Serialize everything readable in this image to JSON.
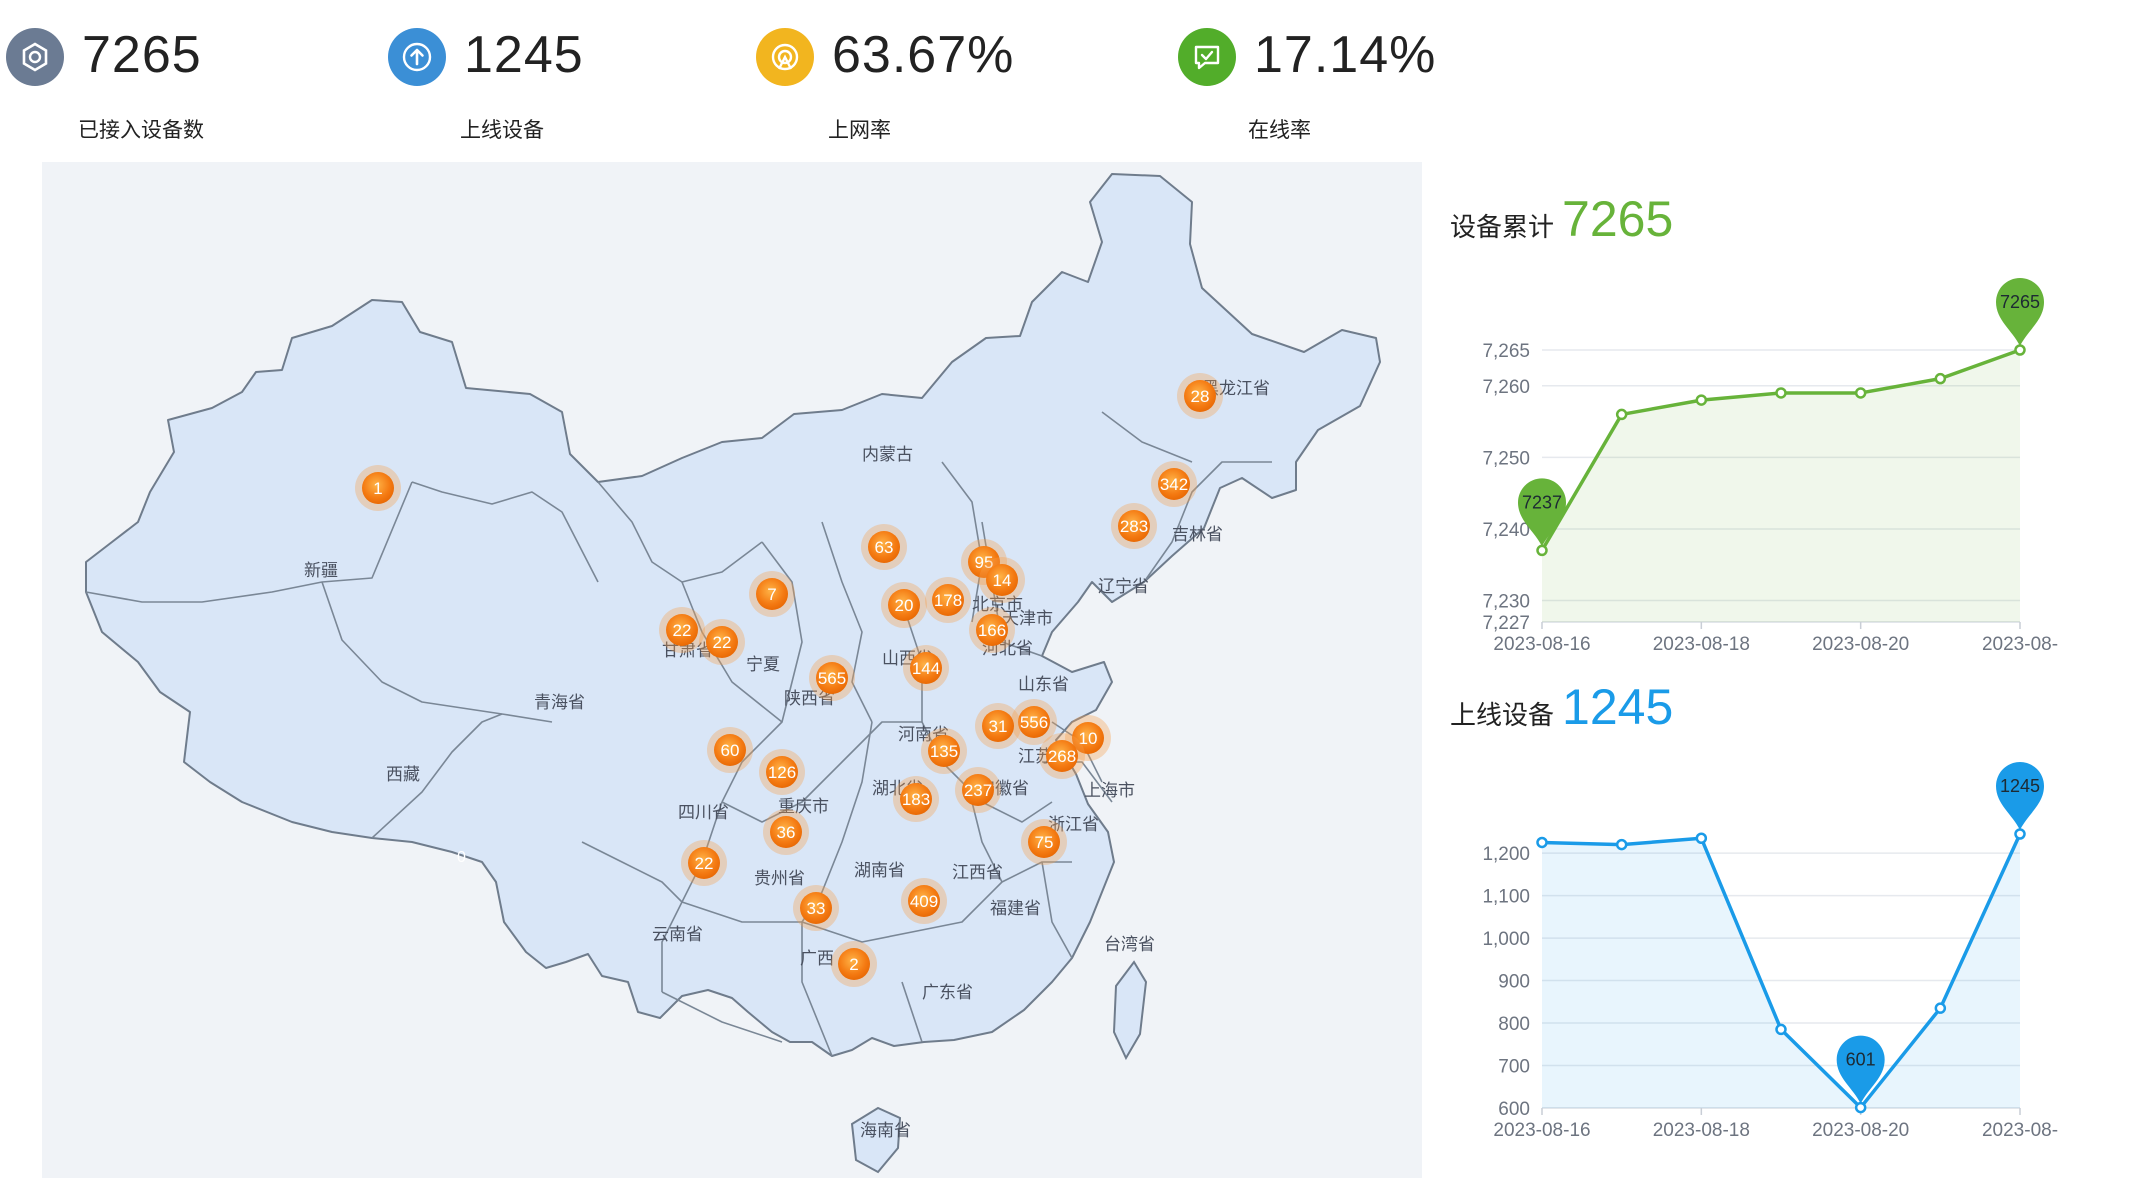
{
  "stats": [
    {
      "value": "7265",
      "label": "已接入设备数",
      "color": "#6b7b93",
      "icon": "hexagon-icon"
    },
    {
      "value": "1245",
      "label": "上线设备",
      "color": "#3b8fd6",
      "icon": "upload-icon"
    },
    {
      "value": "63.67%",
      "label": "上网率",
      "color": "#f2b51f",
      "icon": "signal-icon"
    },
    {
      "value": "17.14%",
      "label": "在线率",
      "color": "#52ad2a",
      "icon": "chat-check-icon"
    }
  ],
  "map": {
    "provinces": [
      {
        "name": "黑龙江省",
        "value": 28
      },
      {
        "name": "内蒙古",
        "value": 63
      },
      {
        "name": "新疆",
        "value": 1
      },
      {
        "name": "吉林省",
        "value": 342
      },
      {
        "name": "辽宁省",
        "value": 283
      },
      {
        "name": "北京市",
        "value": 95
      },
      {
        "name": "天津市",
        "value": 14
      },
      {
        "name": "河北省",
        "value": 178
      },
      {
        "name": "山西省",
        "value": 20
      },
      {
        "name": "宁夏",
        "value": 7
      },
      {
        "name": "甘肃省",
        "value": 22
      },
      {
        "name": "青海省",
        "value": 22
      },
      {
        "name": "陕西省",
        "value": 565
      },
      {
        "name": "山东省",
        "value": 166
      },
      {
        "name": "河南省",
        "value": 144
      },
      {
        "name": "江苏省",
        "value": 556
      },
      {
        "name": "安徽省",
        "value": 31
      },
      {
        "name": "上海市",
        "value": 10
      },
      {
        "name": "浙江省",
        "value": 268
      },
      {
        "name": "湖北省",
        "value": 135
      },
      {
        "name": "重庆市",
        "value": 126
      },
      {
        "name": "四川省",
        "value": 60
      },
      {
        "name": "湖南省",
        "value": 183
      },
      {
        "name": "江西省",
        "value": 237
      },
      {
        "name": "贵州省",
        "value": 36
      },
      {
        "name": "福建省",
        "value": 75
      },
      {
        "name": "云南省",
        "value": 22
      },
      {
        "name": "广西",
        "value": 33
      },
      {
        "name": "广东省",
        "value": 409
      },
      {
        "name": "海南省",
        "value": 2
      }
    ],
    "labels": [
      "黑龙江省",
      "内蒙古",
      "新疆",
      "吉林省",
      "辽宁省",
      "北京市",
      "天津市",
      "河北省",
      "山西省",
      "宁夏",
      "甘肃省",
      "青海省",
      "陕西省",
      "山东省",
      "河南省",
      "江苏省",
      "安徽省",
      "上海市",
      "浙江省",
      "湖北省",
      "重庆市",
      "四川省",
      "湖南省",
      "江西省",
      "贵州省",
      "福建省",
      "云南省",
      "广西",
      "广东省",
      "海南省",
      "西藏",
      "台湾省"
    ],
    "stray_value": "0"
  },
  "chart_data": [
    {
      "type": "area",
      "title": "设备累计",
      "headline": "7265",
      "color": "#67b33a",
      "x": [
        "2023-08-16",
        "2023-08-17",
        "2023-08-18",
        "2023-08-19",
        "2023-08-20",
        "2023-08-21",
        "2023-08-22"
      ],
      "x_tick_labels": [
        "2023-08-16",
        "2023-08-18",
        "2023-08-20",
        "2023-08-"
      ],
      "values": [
        7237,
        7256,
        7258,
        7259,
        7259,
        7261,
        7265
      ],
      "ylim": [
        7227,
        7265
      ],
      "y_ticks": [
        7227,
        7230,
        7240,
        7250,
        7260,
        7265
      ],
      "y_tick_labels": [
        "7,227",
        "7,230",
        "7,240",
        "7,250",
        "7,260",
        "7,265"
      ],
      "markers": [
        {
          "index": 0,
          "label": "7237"
        },
        {
          "index": 6,
          "label": "7265"
        }
      ],
      "grid": true
    },
    {
      "type": "area",
      "title": "上线设备",
      "headline": "1245",
      "color": "#1a9be8",
      "x": [
        "2023-08-16",
        "2023-08-17",
        "2023-08-18",
        "2023-08-19",
        "2023-08-20",
        "2023-08-21",
        "2023-08-22"
      ],
      "x_tick_labels": [
        "2023-08-16",
        "2023-08-18",
        "2023-08-20",
        "2023-08-"
      ],
      "values": [
        1225,
        1220,
        1235,
        785,
        601,
        835,
        1245
      ],
      "ylim": [
        600,
        1245
      ],
      "y_ticks": [
        600,
        700,
        800,
        900,
        1000,
        1100,
        1200
      ],
      "y_tick_labels": [
        "600",
        "700",
        "800",
        "900",
        "1,000",
        "1,100",
        "1,200"
      ],
      "markers": [
        {
          "index": 4,
          "label": "601"
        },
        {
          "index": 6,
          "label": "1245"
        }
      ],
      "grid": true
    }
  ]
}
